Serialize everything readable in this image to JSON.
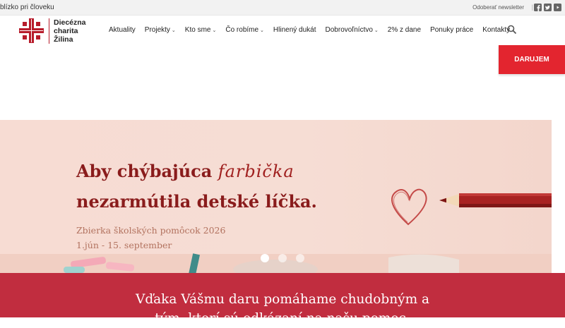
{
  "topbar": {
    "tagline": "blízko pri človeku",
    "newsletter": "Odoberať newsletter",
    "separator": "|",
    "social_icons": [
      "facebook-icon",
      "twitter-icon",
      "youtube-icon"
    ]
  },
  "header": {
    "logo_lines": [
      "Diecézna",
      "charita",
      "Žilina"
    ],
    "logo_color": "#b71c2b",
    "nav": [
      {
        "label": "Aktuality",
        "dropdown": false
      },
      {
        "label": "Projekty",
        "dropdown": true
      },
      {
        "label": "Kto sme",
        "dropdown": true
      },
      {
        "label": "Čo robíme",
        "dropdown": true
      },
      {
        "label": "Hlinený dukát",
        "dropdown": false
      },
      {
        "label": "Dobrovoľníctvo",
        "dropdown": true
      },
      {
        "label": "2% z dane",
        "dropdown": false
      },
      {
        "label": "Ponuky práce",
        "dropdown": false
      },
      {
        "label": "Kontakty",
        "dropdown": false
      }
    ],
    "search_icon": "search-icon",
    "donate_label": "DARUJEM",
    "donate_color": "#e3252f"
  },
  "hero": {
    "line1_a": "Aby chýbajúca",
    "line1_b": "farbička",
    "line2": "nezarmútila detské líčka.",
    "sub1": "Zbierka školských pomôcok 2026",
    "sub2": "1.jún - 15. september",
    "dots_total": 3,
    "active_dot": 1,
    "text_color": "#8a1c1c"
  },
  "band": {
    "text": "Vďaka Vášmu daru pomáhame chudobným a tým, ktorí sú odkázaní na našu pomoc.",
    "color": "#c12d3f"
  }
}
